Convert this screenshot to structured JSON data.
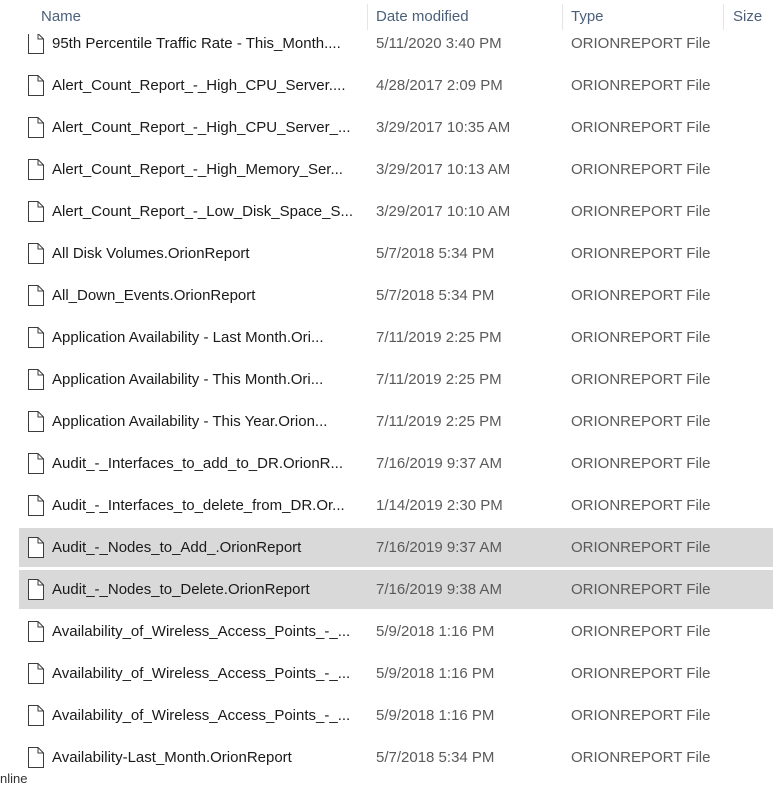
{
  "columns": {
    "name": "Name",
    "date": "Date modified",
    "type": "Type",
    "size": "Size"
  },
  "files": [
    {
      "name": "95th Percentile Traffic Rate - This_Month....",
      "date": "5/11/2020 3:40 PM",
      "type": "ORIONREPORT File",
      "selected": false
    },
    {
      "name": "Alert_Count_Report_-_High_CPU_Server....",
      "date": "4/28/2017 2:09 PM",
      "type": "ORIONREPORT File",
      "selected": false
    },
    {
      "name": "Alert_Count_Report_-_High_CPU_Server_...",
      "date": "3/29/2017 10:35 AM",
      "type": "ORIONREPORT File",
      "selected": false
    },
    {
      "name": "Alert_Count_Report_-_High_Memory_Ser...",
      "date": "3/29/2017 10:13 AM",
      "type": "ORIONREPORT File",
      "selected": false
    },
    {
      "name": "Alert_Count_Report_-_Low_Disk_Space_S...",
      "date": "3/29/2017 10:10 AM",
      "type": "ORIONREPORT File",
      "selected": false
    },
    {
      "name": "All Disk Volumes.OrionReport",
      "date": "5/7/2018 5:34 PM",
      "type": "ORIONREPORT File",
      "selected": false
    },
    {
      "name": "All_Down_Events.OrionReport",
      "date": "5/7/2018 5:34 PM",
      "type": "ORIONREPORT File",
      "selected": false
    },
    {
      "name": "Application Availability - Last Month.Ori...",
      "date": "7/11/2019 2:25 PM",
      "type": "ORIONREPORT File",
      "selected": false
    },
    {
      "name": "Application Availability - This Month.Ori...",
      "date": "7/11/2019 2:25 PM",
      "type": "ORIONREPORT File",
      "selected": false
    },
    {
      "name": "Application Availability - This Year.Orion...",
      "date": "7/11/2019 2:25 PM",
      "type": "ORIONREPORT File",
      "selected": false
    },
    {
      "name": "Audit_-_Interfaces_to_add_to_DR.OrionR...",
      "date": "7/16/2019 9:37 AM",
      "type": "ORIONREPORT File",
      "selected": false
    },
    {
      "name": "Audit_-_Interfaces_to_delete_from_DR.Or...",
      "date": "1/14/2019 2:30 PM",
      "type": "ORIONREPORT File",
      "selected": false
    },
    {
      "name": "Audit_-_Nodes_to_Add_.OrionReport",
      "date": "7/16/2019 9:37 AM",
      "type": "ORIONREPORT File",
      "selected": true
    },
    {
      "name": "Audit_-_Nodes_to_Delete.OrionReport",
      "date": "7/16/2019 9:38 AM",
      "type": "ORIONREPORT File",
      "selected": true
    },
    {
      "name": "Availability_of_Wireless_Access_Points_-_...",
      "date": "5/9/2018 1:16 PM",
      "type": "ORIONREPORT File",
      "selected": false
    },
    {
      "name": "Availability_of_Wireless_Access_Points_-_...",
      "date": "5/9/2018 1:16 PM",
      "type": "ORIONREPORT File",
      "selected": false
    },
    {
      "name": "Availability_of_Wireless_Access_Points_-_...",
      "date": "5/9/2018 1:16 PM",
      "type": "ORIONREPORT File",
      "selected": false
    },
    {
      "name": "Availability-Last_Month.OrionReport",
      "date": "5/7/2018 5:34 PM",
      "type": "ORIONREPORT File",
      "selected": false
    }
  ],
  "bottom_label": "nline",
  "colors": {
    "header_text": "#4c607a",
    "selection": "#d9d9d9",
    "secondary_text": "#5a5a5a"
  },
  "icons": {
    "file": "document-icon"
  }
}
